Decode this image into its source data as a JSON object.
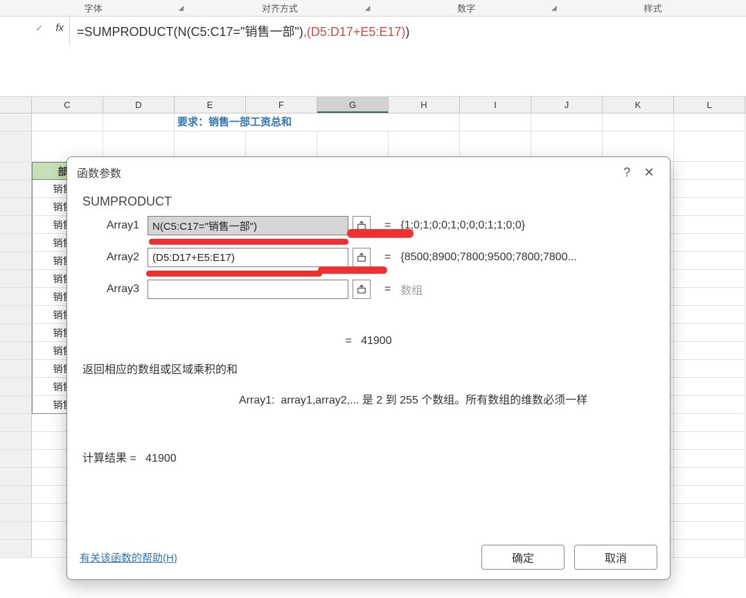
{
  "ribbon": {
    "groups": [
      "字体",
      "对齐方式",
      "数字",
      "样式"
    ]
  },
  "formula_bar": {
    "fx": "fx",
    "formula_prefix": "=SUMPRODUCT(",
    "formula_arg1": "N(C5:C17=\"销售一部\")",
    "formula_sep": ",",
    "formula_arg2": "(D5:D17+E5:E17)",
    "formula_suffix": ")"
  },
  "cols": [
    "C",
    "D",
    "E",
    "F",
    "G",
    "H",
    "I",
    "J",
    "K",
    "L"
  ],
  "selected_col": "G",
  "grid": {
    "title": "要求：销售一部工资总和",
    "header": "部门",
    "rows": [
      "销售一",
      "销售二",
      "销售一",
      "销售三",
      "销售三",
      "销售一",
      "销售三",
      "销售三",
      "销售三",
      "销售一",
      "销售一",
      "销售一",
      "销售三"
    ]
  },
  "dialog": {
    "title": "函数参数",
    "func": "SUMPRODUCT",
    "args": [
      {
        "label": "Array1",
        "value": "N(C5:C17=\"销售一部\")",
        "result": "{1;0;1;0;0;1;0;0;0;1;1;0;0}",
        "gray": false,
        "selected": true
      },
      {
        "label": "Array2",
        "value": "(D5:D17+E5:E17)",
        "result": "{8500;8900;7800;9500;7800;7800...",
        "gray": false,
        "selected": false
      },
      {
        "label": "Array3",
        "value": "",
        "result": "数组",
        "gray": true,
        "selected": false
      }
    ],
    "func_eq": "=",
    "func_result": "41900",
    "desc1": "返回相应的数组或区域乘积的和",
    "desc2_label": "Array1:",
    "desc2_text": "array1,array2,... 是 2 到 255 个数组。所有数组的维数必须一样",
    "calc_label": "计算结果 =",
    "calc_value": "41900",
    "help": "有关该函数的帮助(H)",
    "ok": "确定",
    "cancel": "取消"
  }
}
